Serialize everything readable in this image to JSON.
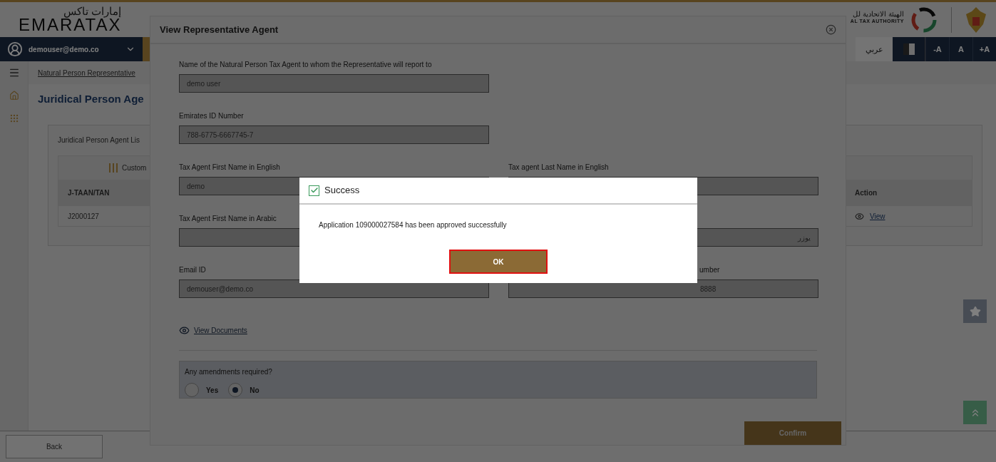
{
  "header": {
    "logo_arabic": "إمارات تاكس",
    "logo": "EMARATAX",
    "authority_arabic": "الهيئة الاتحادية لل",
    "authority": "AL TAX AUTHORITY"
  },
  "user_menu": {
    "email": "demouser@demo.co"
  },
  "toolbar": {
    "language": "عربي",
    "font_buttons": [
      "-A",
      "A",
      "+A"
    ]
  },
  "breadcrumb": "Natural Person Representative",
  "page_title": "Juridical Person Age",
  "card": {
    "title": "Juridical Person Agent Lis",
    "group_header": "Custom",
    "columns": [
      "J-TAAN/TAN",
      "Action"
    ],
    "rows": [
      {
        "id": "J2000127",
        "action": "View"
      }
    ]
  },
  "back_button": "Back",
  "modal": {
    "title": "View Representative Agent",
    "rows": [
      [
        {
          "label": "Name of the Natural Person Tax Agent to whom the Representative will report to",
          "value": "demo user"
        }
      ],
      [
        {
          "label": "Emirates ID Number",
          "value": "788-6775-6667745-7"
        }
      ],
      [
        {
          "label": "Tax Agent First Name in English",
          "value": "demo"
        },
        {
          "label": "Tax agent Last Name in English"
        }
      ],
      [
        {
          "label": "Tax Agent First Name in Arabic"
        },
        {
          "value": "يوزر"
        }
      ],
      [
        {
          "label": "Email ID",
          "value": "demouser@demo.co"
        },
        {
          "label": "umber",
          "value": "8888"
        }
      ]
    ],
    "documents_link": "View Documents",
    "amendments": {
      "question": "Any amendments required?",
      "options": [
        {
          "label": "Yes",
          "selected": false
        },
        {
          "label": "No",
          "selected": true
        }
      ]
    },
    "confirm_button": "Confirm"
  },
  "alert": {
    "title": "Success",
    "message": "Application 109000027584 has been approved successfully",
    "button": "OK"
  }
}
